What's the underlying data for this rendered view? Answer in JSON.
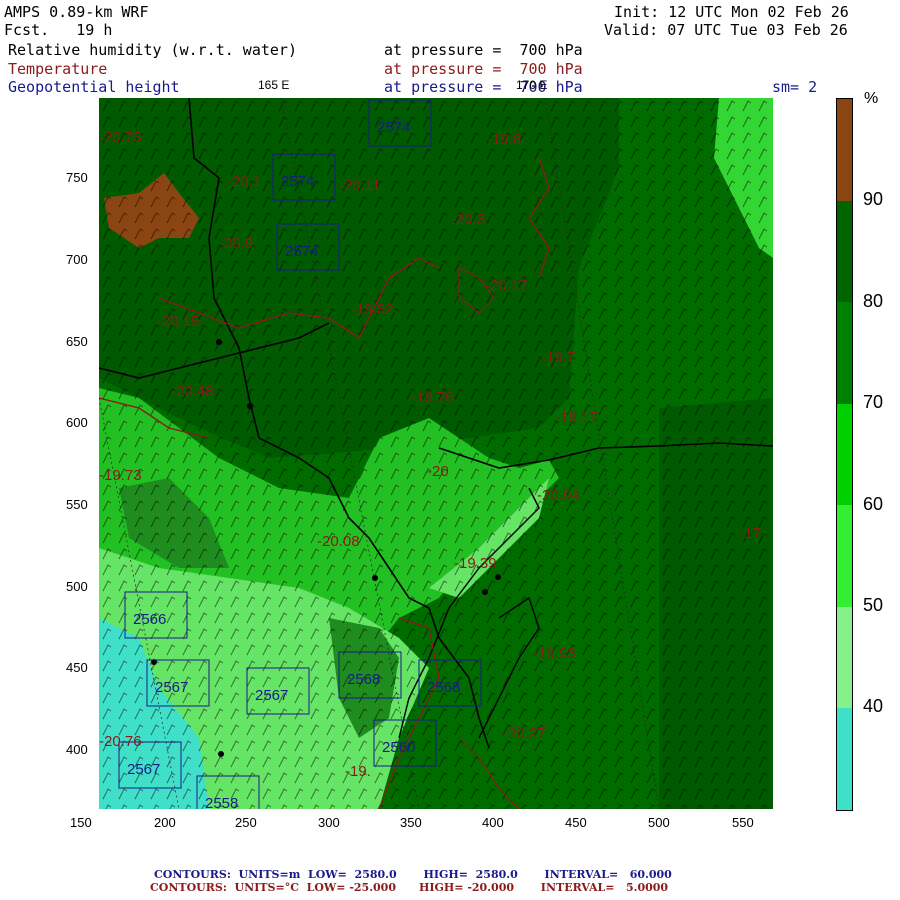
{
  "header": {
    "model": "AMPS 0.89-km WRF",
    "fcst": "Fcst.   19 h",
    "init": "Init: 12 UTC Mon 02 Feb 26",
    "valid": "Valid: 07 UTC Tue 03 Feb 26",
    "field1": "Relative humidity (w.r.t. water)",
    "field2": "Temperature",
    "field3": "Geopotential height",
    "level1": "at pressure =  700 hPa",
    "level2": "at pressure =  700 hPa",
    "level3": "at pressure =  700 hPa",
    "smooth": "sm= 2",
    "lon_label_1": "165 E",
    "lon_label_2": "170 E"
  },
  "axes": {
    "x_ticks": [
      "150",
      "200",
      "250",
      "300",
      "350",
      "400",
      "450",
      "500",
      "550"
    ],
    "y_ticks": [
      "750",
      "700",
      "650",
      "600",
      "550",
      "500",
      "450",
      "400"
    ]
  },
  "colorbar": {
    "unit": "%",
    "labels": [
      "90",
      "80",
      "70",
      "60",
      "50",
      "40"
    ],
    "colors": [
      "#8b4513",
      "#006400",
      "#008000",
      "#00c800",
      "#66ff66",
      "#40e0c8"
    ]
  },
  "height_labels": [
    "2574",
    "2574",
    "2574",
    "2566",
    "2567",
    "2567",
    "2567",
    "2568",
    "2568",
    "2560",
    "2558"
  ],
  "temperature_labels": [
    "20.73",
    "20.1",
    "20.11",
    "19.8",
    "20.3",
    "20.17",
    "19.82",
    "20.15",
    "20.48",
    "19.76",
    "19.7",
    "19.17",
    "19.73",
    "20",
    "20.04",
    "20.08",
    "19.39",
    "19.93",
    "20.27",
    "19.",
    "20.76",
    "20.9",
    "17"
  ],
  "footer": {
    "line1": "CONTOURS:  UNITS=m  LOW=  2580.0       HIGH=  2580.0       INTERVAL=   60.000",
    "line2": "CONTOURS:  UNITS=°C  LOW= -25.000      HIGH= -20.000       INTERVAL=   5.0000"
  }
}
